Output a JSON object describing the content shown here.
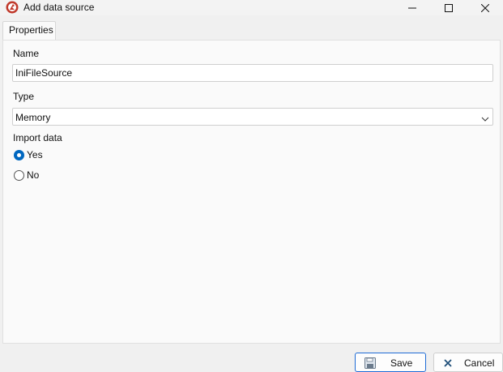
{
  "window": {
    "title": "Add data source",
    "icon": "app-logo-icon",
    "controls": [
      "minimize-icon",
      "maximize-icon",
      "close-icon"
    ]
  },
  "tabs": [
    {
      "label": "Properties",
      "active": true
    }
  ],
  "form": {
    "name_label": "Name",
    "name_value": "IniFileSource",
    "type_label": "Type",
    "type_value": "Memory",
    "import_label": "Import data",
    "import_options": [
      {
        "label": "Yes",
        "checked": true
      },
      {
        "label": "No",
        "checked": false
      }
    ]
  },
  "buttons": {
    "save_label": "Save",
    "save_icon": "floppy-disk-icon",
    "cancel_label": "Cancel",
    "cancel_icon": "x-icon"
  },
  "colors": {
    "accent": "#0067c0",
    "app_icon": "#c0392b",
    "primary_border": "#1e6bd6"
  }
}
